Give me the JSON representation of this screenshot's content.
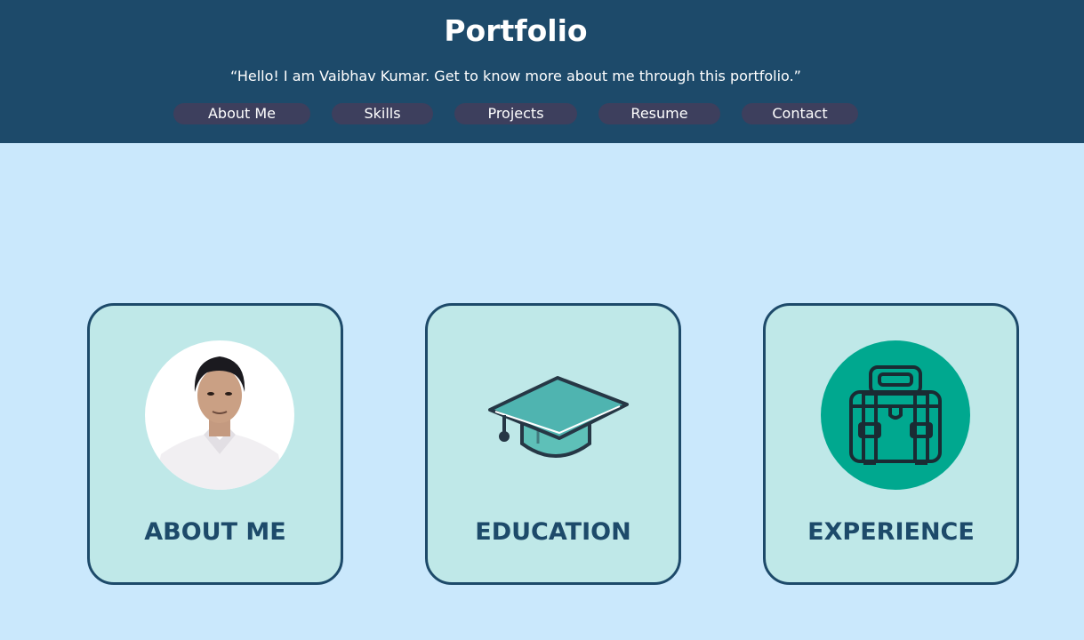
{
  "header": {
    "title": "Portfolio",
    "tagline": "“Hello! I am Vaibhav Kumar. Get to know more about me through this portfolio.”",
    "nav": [
      "About Me",
      "Skills",
      "Projects",
      "Resume",
      "Contact"
    ]
  },
  "cards": [
    {
      "label": "ABOUT ME",
      "icon": "profile-photo"
    },
    {
      "label": "EDUCATION",
      "icon": "graduation-cap-icon"
    },
    {
      "label": "EXPERIENCE",
      "icon": "briefcase-icon"
    }
  ],
  "colors": {
    "header_bg": "#1d4a6a",
    "page_bg": "#cae8fc",
    "nav_button_bg": "#3d3f5d",
    "card_bg": "#bfe8e8",
    "card_border": "#1d4a6a",
    "accent_teal": "#00a88f"
  }
}
